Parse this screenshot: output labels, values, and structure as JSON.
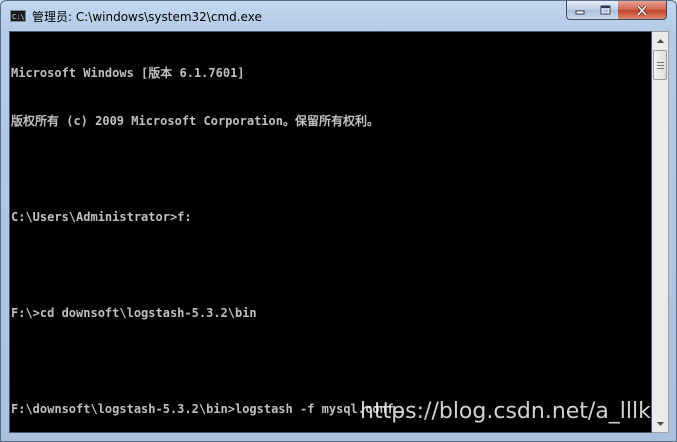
{
  "window": {
    "title": "管理员: C:\\windows\\system32\\cmd.exe",
    "icon": "cmd-icon"
  },
  "console": {
    "lines": [
      "Microsoft Windows [版本 6.1.7601]",
      "版权所有 (c) 2009 Microsoft Corporation。保留所有权利。",
      "",
      "C:\\Users\\Administrator>f:",
      "",
      "F:\\>cd downsoft\\logstash-5.3.2\\bin",
      "",
      "F:\\downsoft\\logstash-5.3.2\\bin>logstash -f mysql.conf"
    ]
  },
  "watermark": "https://blog.csdn.net/a_lllk",
  "colors": {
    "console_bg": "#000000",
    "console_text": "#c0c0c0",
    "close_button": "#c7432c",
    "frame": "#b4cbe6"
  }
}
